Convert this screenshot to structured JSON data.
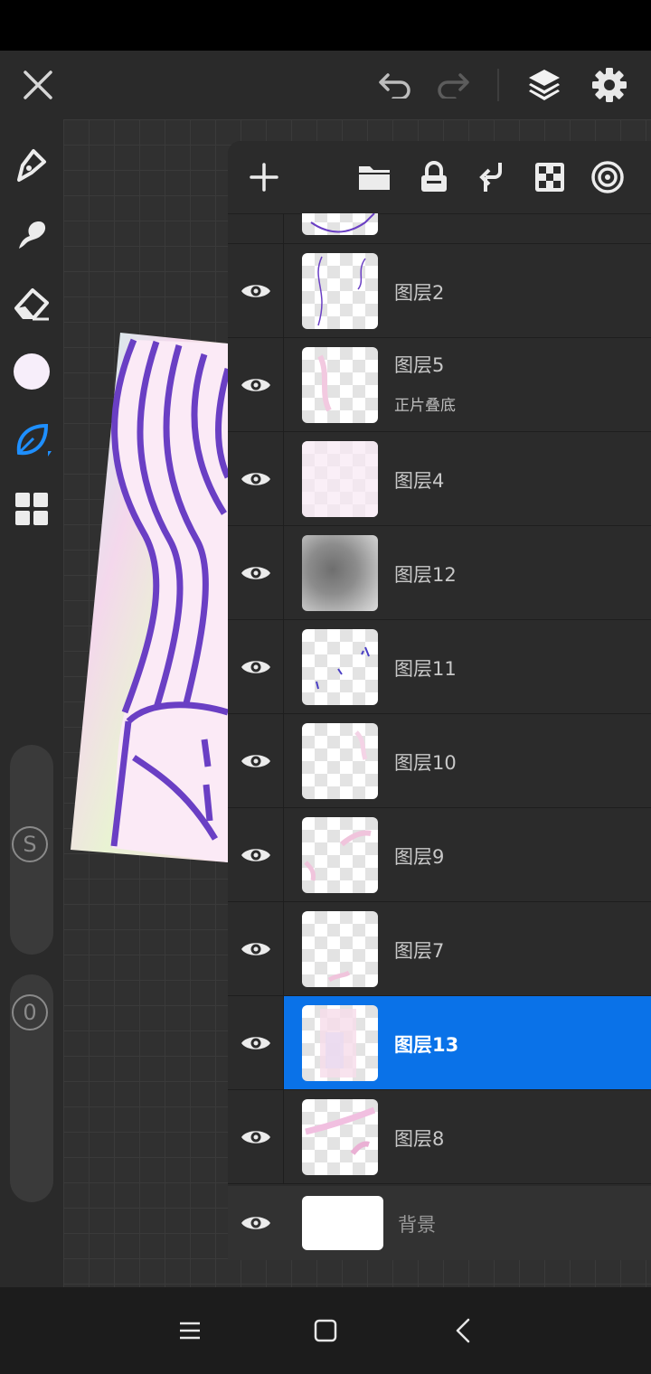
{
  "app": {
    "accent_color": "#0a72e8"
  },
  "topbar": {
    "icons": [
      "close-icon",
      "undo-icon",
      "redo-icon",
      "layers-icon",
      "settings-icon"
    ]
  },
  "sidebar": {
    "tools": [
      "pen-tool-icon",
      "smudge-icon",
      "eraser-icon",
      "color-swatch",
      "brush-leaf-icon",
      "grid-icon"
    ],
    "current_color": "#f7eefa",
    "size_knob_label": "S",
    "opacity_knob_label": "0"
  },
  "layers_panel": {
    "toolbar_icons": [
      "add-icon",
      "folder-icon",
      "lock-icon",
      "merge-down-icon",
      "checkerboard-icon",
      "target-icon"
    ],
    "layers": [
      {
        "name": "图层2",
        "mode": ""
      },
      {
        "name": "图层5",
        "mode": "正片叠底"
      },
      {
        "name": "图层4",
        "mode": ""
      },
      {
        "name": "图层12",
        "mode": ""
      },
      {
        "name": "图层11",
        "mode": ""
      },
      {
        "name": "图层10",
        "mode": ""
      },
      {
        "name": "图层9",
        "mode": ""
      },
      {
        "name": "图层7",
        "mode": ""
      },
      {
        "name": "图层13",
        "mode": "",
        "selected": true
      },
      {
        "name": "图层8",
        "mode": ""
      }
    ],
    "background_layer": {
      "name": "背景"
    }
  },
  "navbar": {
    "icons": [
      "menu-icon",
      "home-icon",
      "back-icon"
    ]
  }
}
